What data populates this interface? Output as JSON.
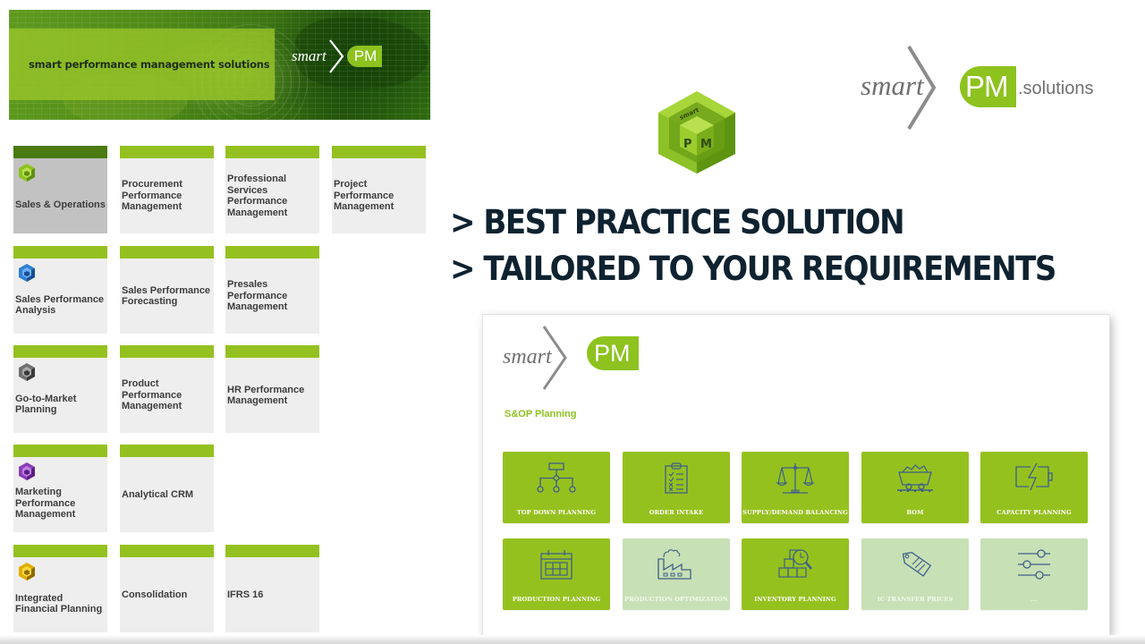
{
  "banner": {
    "tagline": "smart performance management solutions",
    "logo_smart": "smart",
    "logo_pm": "PM"
  },
  "modules": [
    {
      "label": "Sales & Operations",
      "icon": "hex-cube-green-icon",
      "active": true
    },
    {
      "label": "Procurement Performance Management"
    },
    {
      "label": "Professional Services Performance Management"
    },
    {
      "label": "Project Performance Management"
    },
    {
      "label": "Sales Performance Analysis",
      "icon": "hex-cube-blue-icon"
    },
    {
      "label": "Sales Performance Forecasting"
    },
    {
      "label": "Presales Performance Management"
    },
    {
      "label": "Go-to-Market Planning",
      "icon": "hex-cube-gray-icon"
    },
    {
      "label": "Product Performance Management"
    },
    {
      "label": "HR Performance Management"
    },
    {
      "label": "Marketing Performance Management",
      "icon": "hex-cube-purple-icon"
    },
    {
      "label": "Analytical CRM"
    },
    {
      "label": "Integrated Financial Planning",
      "icon": "hex-cube-gold-icon"
    },
    {
      "label": "Consolidation"
    },
    {
      "label": "IFRS 16"
    }
  ],
  "brand": {
    "smart": "smart",
    "pm": "PM",
    "suffix": ".solutions"
  },
  "cube": {
    "top_text": "smart",
    "p": "P",
    "m": "M"
  },
  "headline": {
    "line1": "> BEST PRACTICE SOLUTION",
    "line2": "> TAILORED TO YOUR REQUIREMENTS"
  },
  "app": {
    "logo_smart": "smart",
    "logo_pm": "PM",
    "section_title": "S&OP Planning",
    "tiles": [
      {
        "label": "TOP DOWN PLANNING",
        "icon": "hierarchy-icon",
        "enabled": true
      },
      {
        "label": "ORDER INTAKE",
        "icon": "clipboard-checklist-icon",
        "enabled": true
      },
      {
        "label": "SUPPLY/DEMAND BALANCING",
        "icon": "scales-icon",
        "enabled": true
      },
      {
        "label": "BOM",
        "icon": "mine-cart-icon",
        "enabled": true
      },
      {
        "label": "CAPACITY PLANNING",
        "icon": "battery-charging-icon",
        "enabled": true
      },
      {
        "label": "PRODUCTION PLANNING",
        "icon": "calendar-icon",
        "enabled": true
      },
      {
        "label": "PRODUCTION OPTIMIZATION",
        "icon": "factory-icon",
        "enabled": false
      },
      {
        "label": "INVENTORY PLANNING",
        "icon": "boxes-search-icon",
        "enabled": true
      },
      {
        "label": "IC TRANSFER PRICES",
        "icon": "price-tag-icon",
        "enabled": false
      },
      {
        "label": "...",
        "icon": "sliders-icon",
        "enabled": false
      }
    ]
  },
  "colors": {
    "brand_green": "#8dc21f",
    "tile_green": "#95c11f",
    "tile_disabled": "#c7e0b5",
    "active_bar": "#4a7a10",
    "headline": "#0f2230"
  }
}
